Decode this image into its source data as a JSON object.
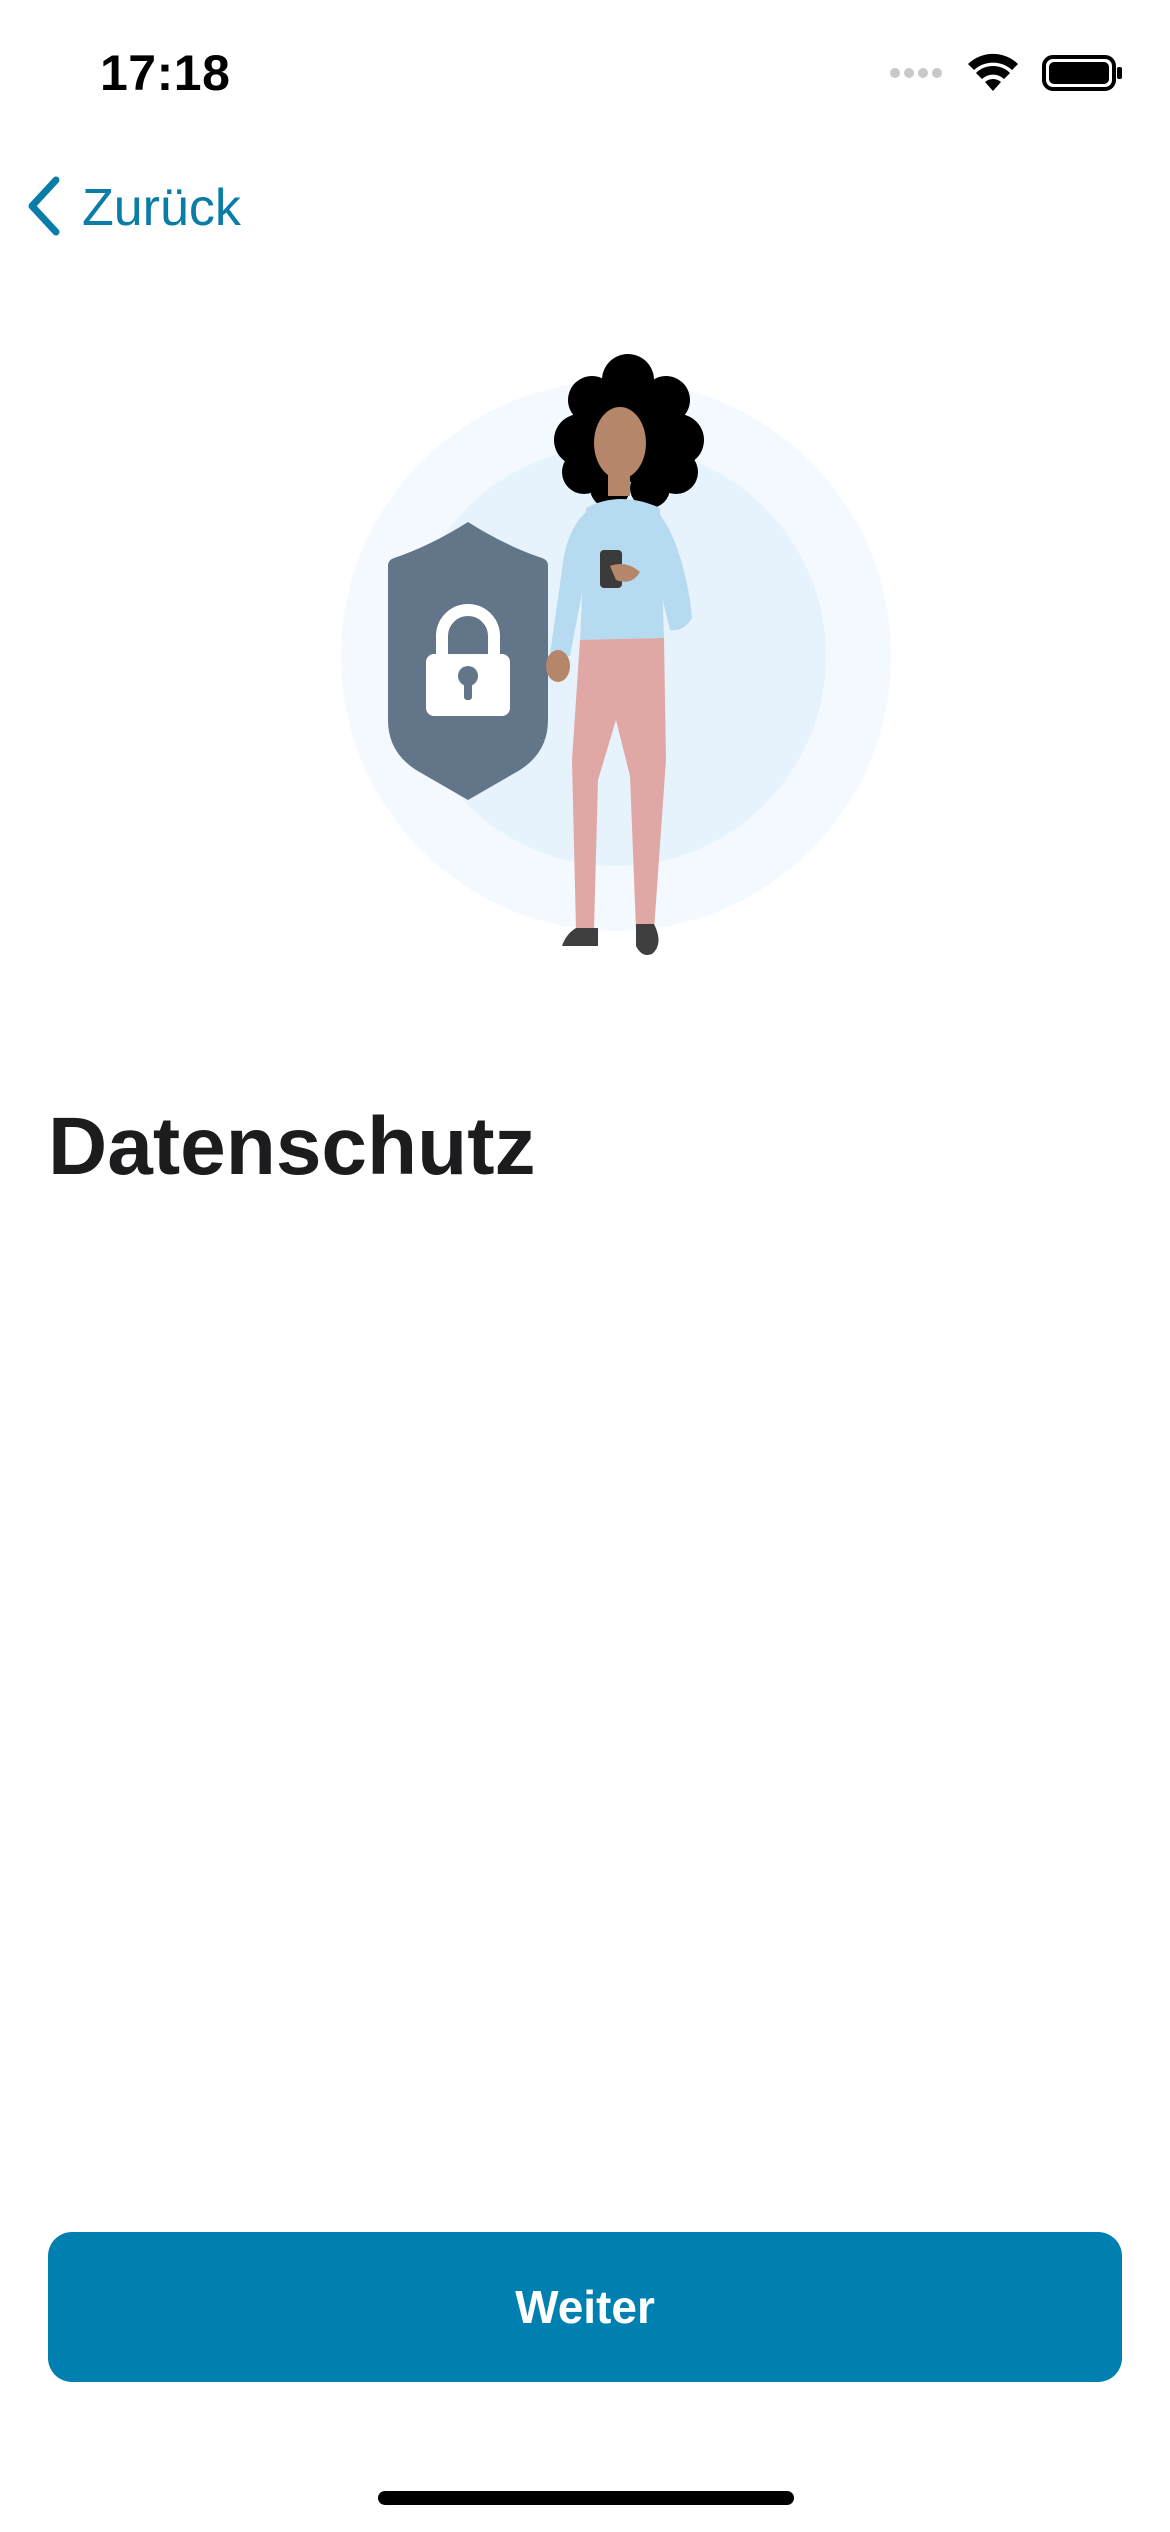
{
  "status_bar": {
    "time": "17:18"
  },
  "navigation": {
    "back_label": "Zurück"
  },
  "page": {
    "title": "Datenschutz"
  },
  "actions": {
    "continue_label": "Weiter"
  },
  "colors": {
    "accent": "#0080b0",
    "link": "#0a7ca8",
    "shield": "#637588",
    "background": "#ffffff"
  },
  "icons": [
    "cellular-signal-icon",
    "wifi-icon",
    "battery-icon",
    "chevron-left-icon",
    "shield-lock-icon"
  ]
}
